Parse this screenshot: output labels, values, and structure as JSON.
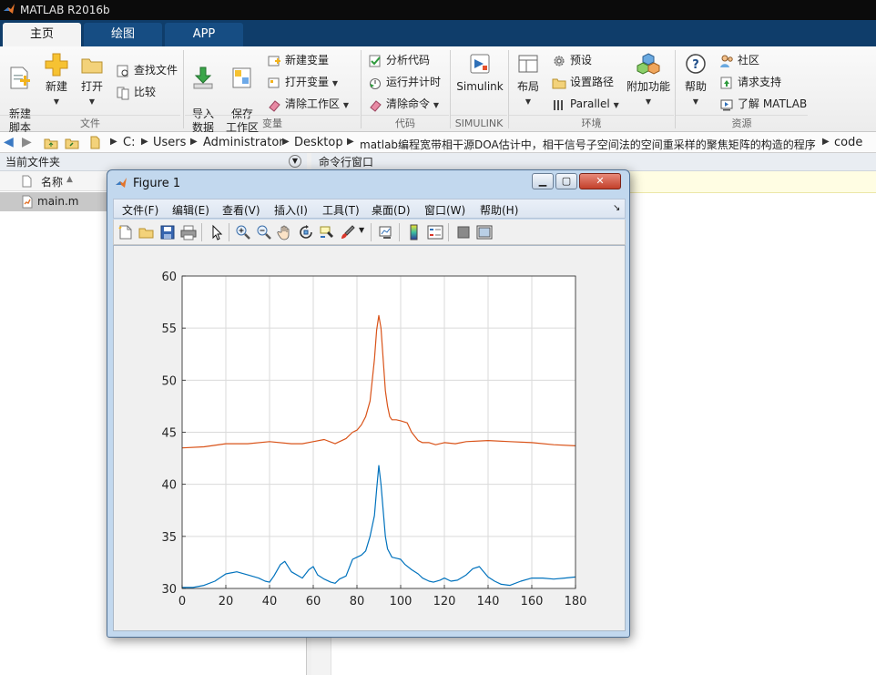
{
  "window": {
    "title": "MATLAB R2016b"
  },
  "tabs": [
    {
      "label": "主页",
      "active": true
    },
    {
      "label": "绘图",
      "active": false
    },
    {
      "label": "APP",
      "active": false
    }
  ],
  "ribbon": {
    "file": {
      "group_label": "文件",
      "new_script": "新建\n脚本",
      "new": "新建",
      "open": "打开",
      "find_files": "查找文件",
      "compare": "比较"
    },
    "variable": {
      "group_label": "变量",
      "import_data": "导入\n数据",
      "save_workspace": "保存\n工作区",
      "new_variable": "新建变量",
      "open_variable": "打开变量",
      "clear_workspace": "清除工作区"
    },
    "code": {
      "group_label": "代码",
      "analyze_code": "分析代码",
      "run_and_time": "运行并计时",
      "clear_commands": "清除命令"
    },
    "simulink": {
      "group_label": "SIMULINK",
      "simulink": "Simulink"
    },
    "environment": {
      "group_label": "环境",
      "layout": "布局",
      "preferences": "预设",
      "set_path": "设置路径",
      "parallel": "Parallel",
      "add_ons": "附加功能"
    },
    "resources": {
      "group_label": "资源",
      "help": "帮助",
      "community": "社区",
      "request_support": "请求支持",
      "learn_matlab": "了解 MATLAB"
    }
  },
  "address_bar": {
    "path": [
      "C:",
      "Users",
      "Administrator",
      "Desktop",
      "matlab编程宽带相干源DOA估计中，相干信号子空间法的空间重采样的聚焦矩阵的构造的程序",
      "code"
    ]
  },
  "current_folder": {
    "title": "当前文件夹",
    "column_name": "名称",
    "files": [
      {
        "name": "main.m",
        "selected": true
      }
    ]
  },
  "command_window": {
    "title": "命令行窗口"
  },
  "figure": {
    "title": "Figure 1",
    "menu": [
      "文件(F)",
      "编辑(E)",
      "查看(V)",
      "插入(I)",
      "工具(T)",
      "桌面(D)",
      "窗口(W)",
      "帮助(H)"
    ],
    "toolbar": [
      "new-figure-icon",
      "open-file-icon",
      "save-icon",
      "print-icon",
      "select-arrow-icon",
      "zoom-in-icon",
      "zoom-out-icon",
      "pan-hand-icon",
      "rotate-3d-icon",
      "data-cursor-icon",
      "brush-icon",
      "link-plot-icon",
      "colorbar-icon",
      "legend-icon",
      "hide-plot-tools-icon",
      "show-plot-tools-icon"
    ]
  },
  "chart_data": {
    "type": "line",
    "title": "",
    "xlabel": "",
    "ylabel": "",
    "xlim": [
      0,
      180
    ],
    "ylim": [
      30,
      60
    ],
    "xticks": [
      0,
      20,
      40,
      60,
      80,
      100,
      120,
      140,
      160,
      180
    ],
    "yticks": [
      30,
      35,
      40,
      45,
      50,
      55,
      60
    ],
    "grid": true,
    "legend": "none",
    "series": [
      {
        "color": "#0072bd",
        "x": [
          0,
          5,
          10,
          15,
          20,
          25,
          30,
          35,
          38,
          40,
          42,
          45,
          47,
          50,
          55,
          58,
          60,
          62,
          65,
          68,
          70,
          72,
          75,
          78,
          80,
          82,
          84,
          86,
          88,
          89,
          90,
          91,
          92,
          93,
          94,
          96,
          98,
          100,
          102,
          105,
          108,
          110,
          113,
          115,
          118,
          120,
          123,
          126,
          130,
          133,
          136,
          138,
          140,
          143,
          146,
          150,
          155,
          160,
          165,
          170,
          175,
          180
        ],
        "y": [
          30.1,
          30.1,
          30.3,
          30.7,
          31.4,
          31.6,
          31.3,
          31.0,
          30.7,
          30.6,
          31.2,
          32.3,
          32.6,
          31.6,
          31.0,
          31.8,
          32.1,
          31.3,
          30.9,
          30.6,
          30.5,
          30.9,
          31.2,
          32.8,
          33.0,
          33.2,
          33.6,
          35.0,
          37.0,
          39.5,
          41.8,
          40.0,
          37.5,
          35.0,
          33.8,
          33.0,
          32.9,
          32.8,
          32.3,
          31.8,
          31.4,
          31.0,
          30.7,
          30.6,
          30.8,
          31.0,
          30.7,
          30.8,
          31.3,
          31.9,
          32.1,
          31.6,
          31.1,
          30.7,
          30.4,
          30.3,
          30.7,
          31.0,
          31.0,
          30.9,
          31.0,
          31.1
        ]
      },
      {
        "color": "#d95319",
        "x": [
          0,
          10,
          20,
          30,
          40,
          50,
          55,
          60,
          65,
          70,
          75,
          78,
          80,
          82,
          84,
          86,
          88,
          89,
          90,
          91,
          92,
          93,
          94,
          95,
          96,
          98,
          100,
          103,
          105,
          108,
          110,
          113,
          116,
          120,
          125,
          130,
          140,
          150,
          160,
          170,
          180
        ],
        "y": [
          43.5,
          43.6,
          43.9,
          43.9,
          44.1,
          43.9,
          43.9,
          44.1,
          44.3,
          43.9,
          44.4,
          45.0,
          45.2,
          45.7,
          46.5,
          48.0,
          52.0,
          54.8,
          56.2,
          55.0,
          52.0,
          49.0,
          47.5,
          46.5,
          46.2,
          46.2,
          46.1,
          45.9,
          45.0,
          44.2,
          44.0,
          44.0,
          43.8,
          44.0,
          43.9,
          44.1,
          44.2,
          44.1,
          44.0,
          43.8,
          43.7
        ]
      }
    ]
  }
}
